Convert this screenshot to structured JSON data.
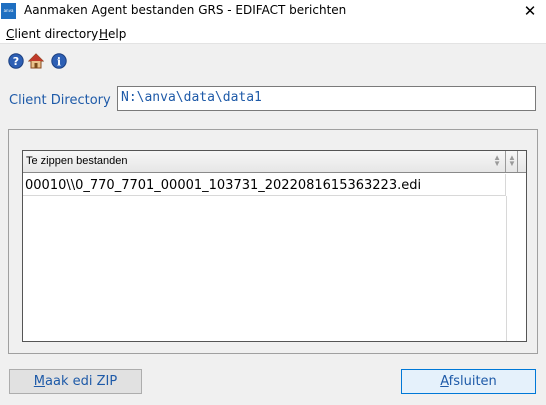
{
  "window": {
    "title": "Aanmaken Agent bestanden GRS - EDIFACT berichten",
    "app_icon_text": "anva",
    "close_symbol": "✕"
  },
  "menu": {
    "items": [
      {
        "accel": "C",
        "rest": "lient directory"
      },
      {
        "accel": "H",
        "rest": "elp"
      }
    ]
  },
  "toolbar": {
    "icons": [
      "help-icon",
      "home-icon",
      "info-icon"
    ]
  },
  "client_directory": {
    "label": "Client Directory",
    "value": "N:\\anva\\data\\data1"
  },
  "grid": {
    "columns": [
      "Te zippen bestanden"
    ],
    "rows": [
      [
        "00010\\\\0_770_7701_00001_103731_2022081615363223.edi"
      ]
    ]
  },
  "buttons": {
    "zip": {
      "accel": "M",
      "rest": "aak edi ZIP"
    },
    "close": {
      "accel": "A",
      "rest": "fsluiten"
    }
  },
  "colors": {
    "accent_text": "#1e5aa8",
    "focus_border": "#0078d7"
  }
}
